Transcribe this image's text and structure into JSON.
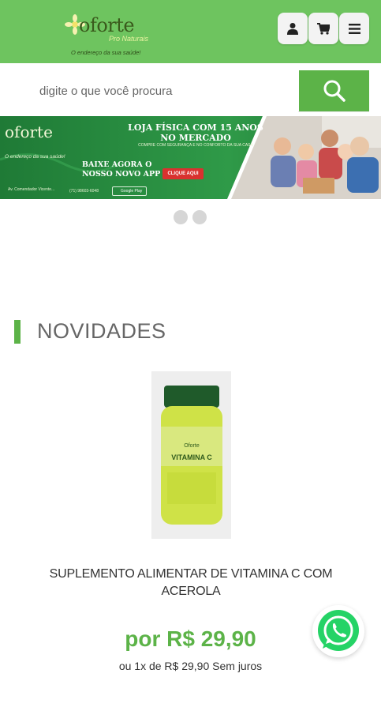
{
  "header": {
    "logo_word": "oforte",
    "logo_sub": "Pro Naturais",
    "logo_tagline": "O endereço da sua saúde!",
    "bg_color": "#6ec45f"
  },
  "actions": [
    {
      "icon": "user-icon"
    },
    {
      "icon": "cart-icon"
    },
    {
      "icon": "menu-icon"
    }
  ],
  "search": {
    "placeholder": "digite o que você procura",
    "button_icon": "search-icon",
    "accent": "#5cb348"
  },
  "banner": {
    "logo_word": "oforte",
    "logo_tagline": "O endereço da sua saúde!",
    "headline": "LOJA FÍSICA COM 15 ANOS NO MERCADO",
    "subline": "COMPRE COM SEGURANÇA E NO CONFORTO DA SUA CASA",
    "app_text": "BAIXE AGORA O NOSSO NOVO APP",
    "cta": "CLIQUE AQUI",
    "address": "Av. Comendador Vicente...",
    "phone": "(71) 98603-6048",
    "store_badge": "Google Play"
  },
  "carousel": {
    "dots": 2
  },
  "section": {
    "title": "NOVIDADES"
  },
  "product": {
    "label_brand": "Oforte",
    "label_title": "VITAMINA C",
    "name": "SUPLEMENTO ALIMENTAR DE VITAMINA C COM ACEROLA",
    "price": "por R$ 29,90",
    "installments": "ou 1x de R$ 29,90 Sem juros"
  },
  "floating": {
    "icon": "whatsapp-icon",
    "color": "#25d366"
  }
}
